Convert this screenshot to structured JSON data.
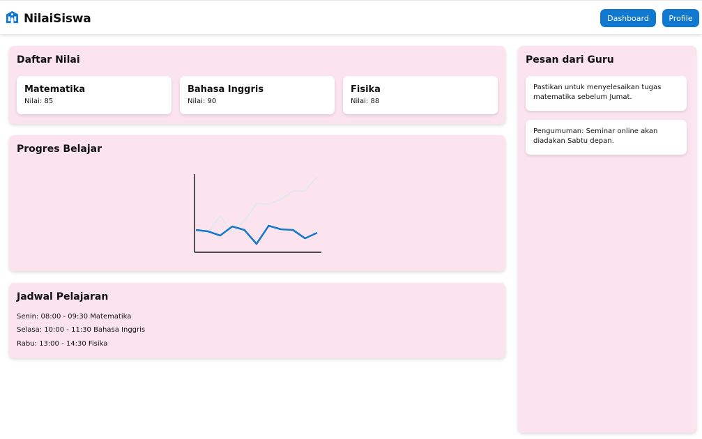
{
  "header": {
    "brand": "NilaiSiswa",
    "brand_icon": "school-icon",
    "nav": [
      "Dashboard",
      "Profile"
    ]
  },
  "grades": {
    "title": "Daftar Nilai",
    "items": [
      {
        "subject": "Matematika",
        "value": "Nilai: 85"
      },
      {
        "subject": "Bahasa Inggris",
        "value": "Nilai: 90"
      },
      {
        "subject": "Fisika",
        "value": "Nilai: 88"
      }
    ]
  },
  "progress": {
    "title": "Progres Belajar"
  },
  "chart_data": {
    "type": "line",
    "x": [
      1,
      2,
      3,
      4,
      5,
      6,
      7,
      8,
      9,
      10,
      11
    ],
    "series": [
      {
        "values": [
          32,
          30,
          24,
          37,
          32,
          12,
          38,
          33,
          32,
          20,
          28
        ]
      },
      {
        "values": [
          30,
          28,
          52,
          28,
          45,
          70,
          69,
          76,
          88,
          88,
          108
        ]
      }
    ],
    "ylim": [
      0,
      112
    ],
    "grid": false,
    "colors": [
      "#1578c8",
      "#dde8f2"
    ]
  },
  "schedule": {
    "title": "Jadwal Pelajaran",
    "items": [
      "Senin: 08:00 - 09:30 Matematika",
      "Selasa: 10:00 - 11:30 Bahasa Inggris",
      "Rabu: 13:00 - 14:30 Fisika"
    ]
  },
  "messages": {
    "title": "Pesan dari Guru",
    "items": [
      "Pastikan untuk menyelesaikan tugas matematika sebelum Jumat.",
      "Pengumuman: Seminar online akan diadakan Sabtu depan."
    ]
  },
  "colors": {
    "accent": "#1079cf",
    "panel": "#fce4ef"
  }
}
